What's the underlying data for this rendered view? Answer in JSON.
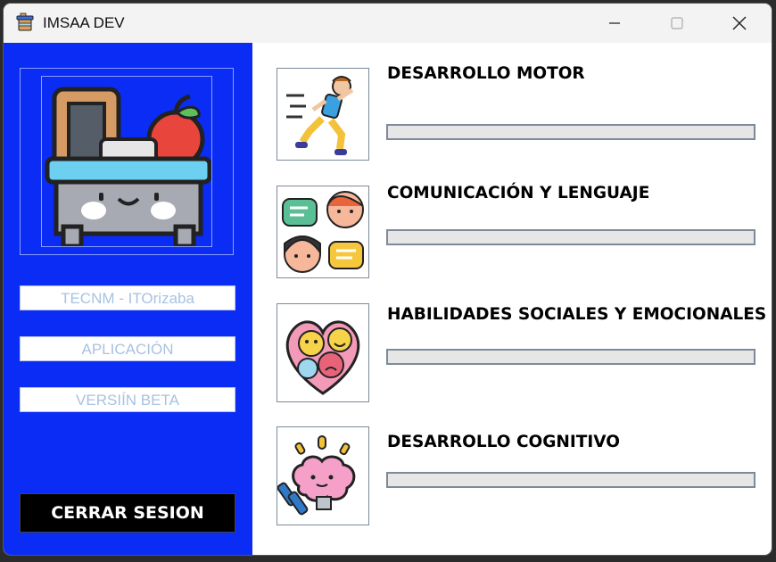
{
  "window": {
    "title": "IMSAA DEV",
    "controls": [
      "minimize-icon",
      "maximize-icon",
      "close-icon"
    ]
  },
  "sidebar": {
    "background": "#0a2cf5",
    "fields": [
      {
        "value": "TECNM - ITOrizaba"
      },
      {
        "value": "APLICACIÓN"
      },
      {
        "value": "VERSIÍN BETA"
      }
    ],
    "logout_label": "CERRAR SESION"
  },
  "areas": [
    {
      "title": "DESARROLLO MOTOR",
      "icon": "running-child-icon",
      "progress": 0
    },
    {
      "title": "COMUNICACIÓN Y LENGUAJE",
      "icon": "chat-faces-icon",
      "progress": 0
    },
    {
      "title": "HABILIDADES SOCIALES Y EMOCIONALES",
      "icon": "emotions-heart-icon",
      "progress": 0
    },
    {
      "title": "DESARROLLO COGNITIVO",
      "icon": "brain-dumbbell-icon",
      "progress": 0
    }
  ]
}
